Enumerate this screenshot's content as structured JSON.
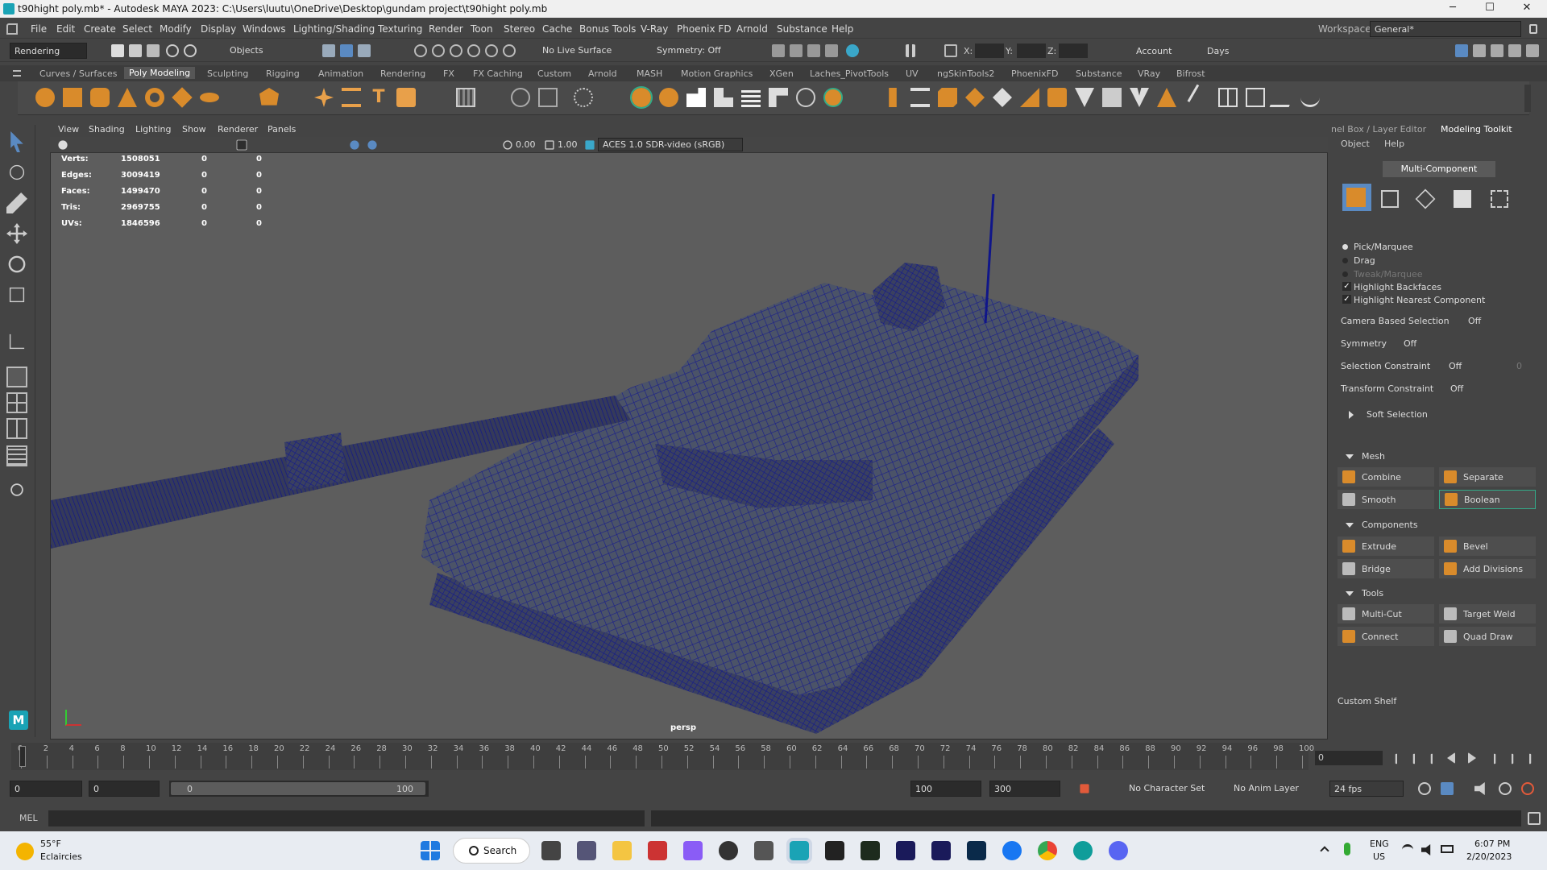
{
  "window": {
    "title": "t90hight poly.mb* - Autodesk MAYA 2023: C:\\Users\\luutu\\OneDrive\\Desktop\\gundam project\\t90hight poly.mb",
    "minimize": "─",
    "maximize": "☐",
    "close": "✕"
  },
  "menu": [
    "File",
    "Edit",
    "Create",
    "Select",
    "Modify",
    "Display",
    "Windows",
    "Lighting/Shading",
    "Texturing",
    "Render",
    "Toon",
    "Stereo",
    "Cache",
    "Bonus Tools",
    "V-Ray",
    "Phoenix FD",
    "Arnold",
    "Substance",
    "Help"
  ],
  "workspace": {
    "label": "Workspace:",
    "value": "General*"
  },
  "status": {
    "menu_set": "Rendering",
    "select_mode": "Objects",
    "live_surface": "No Live Surface",
    "symmetry": "Symmetry: Off",
    "x": "X:",
    "y": "Y:",
    "z": "Z:",
    "account": "Account",
    "days": "Days"
  },
  "shelf_tabs": [
    "Curves / Surfaces",
    "Poly Modeling",
    "Sculpting",
    "Rigging",
    "Animation",
    "Rendering",
    "FX",
    "FX Caching",
    "Custom",
    "Arnold",
    "MASH",
    "Motion Graphics",
    "XGen",
    "Laches_PivotTools",
    "UV",
    "ngSkinTools2",
    "PhoenixFD",
    "Substance",
    "VRay",
    "Bifrost"
  ],
  "shelf_active": "Poly Modeling",
  "viewport": {
    "menus": [
      "View",
      "Shading",
      "Lighting",
      "Show",
      "Renderer",
      "Panels"
    ],
    "exposure": "0.00",
    "gamma": "1.00",
    "color_space": "ACES 1.0 SDR-video (sRGB)",
    "camera": "persp",
    "hud": [
      {
        "label": "Verts:",
        "v1": "1508051",
        "v2": "0",
        "v3": "0"
      },
      {
        "label": "Edges:",
        "v1": "3009419",
        "v2": "0",
        "v3": "0"
      },
      {
        "label": "Faces:",
        "v1": "1499470",
        "v2": "0",
        "v3": "0"
      },
      {
        "label": "Tris:",
        "v1": "2969755",
        "v2": "0",
        "v3": "0"
      },
      {
        "label": "UVs:",
        "v1": "1846596",
        "v2": "0",
        "v3": "0"
      }
    ]
  },
  "panel": {
    "tab1": "nel Box / Layer Editor",
    "tab2": "Modeling Toolkit",
    "menu_object": "Object",
    "menu_help": "Help",
    "mode_button": "Multi-Component",
    "pick": "Pick/Marquee",
    "drag": "Drag",
    "tweak": "Tweak/Marquee",
    "highlight_backfaces": "Highlight Backfaces",
    "highlight_nearest": "Highlight Nearest Component",
    "camera_based": "Camera Based Selection",
    "camera_based_value": "Off",
    "symmetry": "Symmetry",
    "symmetry_value": "Off",
    "selection_constraint": "Selection Constraint",
    "selection_constraint_value": "Off",
    "selection_constraint_num": "0",
    "transform_constraint": "Transform Constraint",
    "transform_constraint_value": "Off",
    "soft_selection": "Soft Selection",
    "mesh_header": "Mesh",
    "combine": "Combine",
    "separate": "Separate",
    "smooth": "Smooth",
    "boolean": "Boolean",
    "components_header": "Components",
    "extrude": "Extrude",
    "bevel": "Bevel",
    "bridge": "Bridge",
    "add_divisions": "Add Divisions",
    "tools_header": "Tools",
    "multi_cut": "Multi-Cut",
    "target_weld": "Target Weld",
    "connect": "Connect",
    "quad_draw": "Quad Draw",
    "custom_shelf": "Custom Shelf"
  },
  "timeline": {
    "ticks": [
      "0",
      "2",
      "4",
      "6",
      "8",
      "10",
      "12",
      "14",
      "16",
      "18",
      "20",
      "22",
      "24",
      "26",
      "28",
      "30",
      "32",
      "34",
      "36",
      "38",
      "40",
      "42",
      "44",
      "46",
      "48",
      "50",
      "52",
      "54",
      "56",
      "58",
      "60",
      "62",
      "64",
      "66",
      "68",
      "70",
      "72",
      "74",
      "76",
      "78",
      "80",
      "82",
      "84",
      "86",
      "88",
      "90",
      "92",
      "94",
      "96",
      "98",
      "100"
    ],
    "current": "0"
  },
  "range": {
    "start": "0",
    "anim_start": "0",
    "slider_start": "0",
    "slider_end": "100",
    "end": "100",
    "anim_end": "300",
    "character": "No Character Set",
    "anim_layer": "No Anim Layer",
    "fps": "24 fps"
  },
  "mel": {
    "label": "MEL"
  },
  "taskbar": {
    "temp": "55°F",
    "weather": "Eclaircies",
    "search": "Search",
    "lang": "ENG",
    "region": "US",
    "time": "6:07 PM",
    "date": "2/20/2023"
  }
}
